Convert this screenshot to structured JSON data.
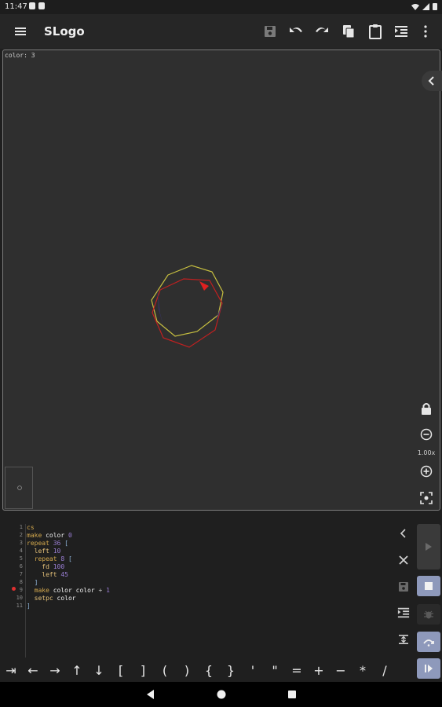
{
  "status": {
    "time": "11:47"
  },
  "appbar": {
    "title": "SLogo",
    "icons": [
      "menu-icon",
      "save-icon",
      "undo-icon",
      "redo-icon",
      "copy-icon",
      "paste-icon",
      "format-indent-icon",
      "more-vert-icon"
    ]
  },
  "canvas": {
    "color_label": "color: 3",
    "zoom": "1.00x",
    "colors": {
      "background": "#2f2f2f",
      "yellow_polygon": "#c8c040",
      "red_polygon": "#c02020",
      "turtle": "#e02020"
    }
  },
  "editor": {
    "line_numbers": [
      "1",
      "2",
      "3",
      "4",
      "5",
      "6",
      "7",
      "8",
      "9",
      "10",
      "11"
    ],
    "lines": [
      [
        {
          "t": "cs",
          "c": "kw"
        }
      ],
      [
        {
          "t": "make ",
          "c": "kw"
        },
        {
          "t": "color ",
          "c": "var"
        },
        {
          "t": "0",
          "c": "num"
        }
      ],
      [
        {
          "t": "repeat ",
          "c": "kw"
        },
        {
          "t": "36 ",
          "c": "num"
        },
        {
          "t": "[",
          "c": "br"
        }
      ],
      [
        {
          "t": "  left ",
          "c": "cmd"
        },
        {
          "t": "10",
          "c": "num"
        }
      ],
      [
        {
          "t": "  repeat ",
          "c": "kw"
        },
        {
          "t": "8 ",
          "c": "num"
        },
        {
          "t": "[",
          "c": "br"
        }
      ],
      [
        {
          "t": "    fd ",
          "c": "cmd"
        },
        {
          "t": "100",
          "c": "num"
        }
      ],
      [
        {
          "t": "    left ",
          "c": "cmd"
        },
        {
          "t": "45",
          "c": "num"
        }
      ],
      [
        {
          "t": "  ]",
          "c": "br"
        }
      ],
      [
        {
          "t": "  make ",
          "c": "kw"
        },
        {
          "t": "color ",
          "c": "var"
        },
        {
          "t": "color ",
          "c": "var"
        },
        {
          "t": "+ ",
          "c": "op"
        },
        {
          "t": "1",
          "c": "num"
        }
      ],
      [
        {
          "t": "  setpc ",
          "c": "cmd"
        },
        {
          "t": "color",
          "c": "var"
        }
      ],
      [
        {
          "t": "]",
          "c": "br"
        }
      ]
    ]
  },
  "symbols": [
    "⇥",
    "←",
    "→",
    "↑",
    "↓",
    "[",
    "]",
    "(",
    ")",
    "{",
    "}",
    "'",
    "\"",
    "=",
    "+",
    "−",
    "*",
    "/"
  ]
}
